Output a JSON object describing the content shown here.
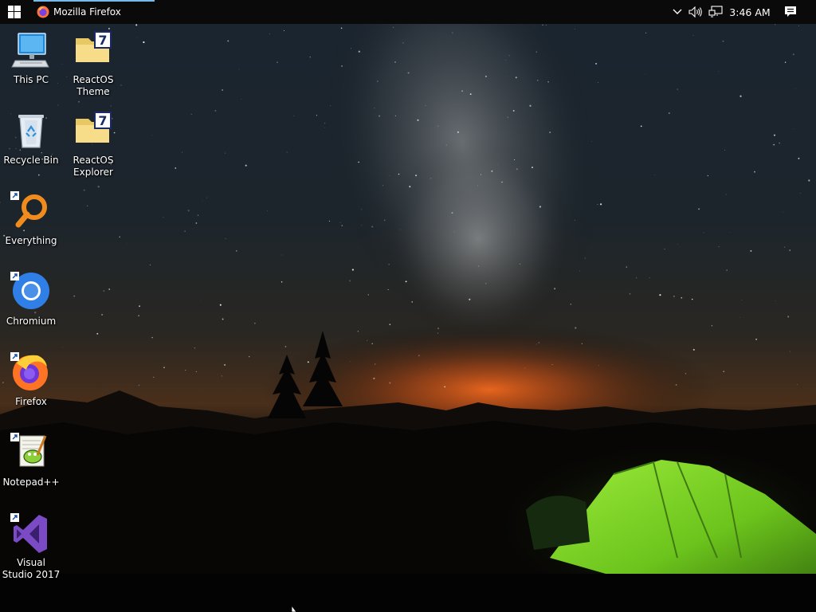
{
  "taskbar": {
    "start_icon": "windows-logo-icon",
    "active_window": {
      "title": "Mozilla Firefox",
      "icon": "firefox-icon"
    },
    "tray": {
      "chevron_icon": "chevron-down-icon",
      "volume_icon": "speaker-icon",
      "network_icon": "network-icon",
      "clock": "3:46 AM",
      "notification_icon": "action-center-icon"
    }
  },
  "desktop": {
    "wallpaper": "night-sky-tent-scene",
    "icons": [
      {
        "label": "This PC",
        "icon": "computer-icon",
        "shortcut": false
      },
      {
        "label": "ReactOS Theme",
        "icon": "folder-icon",
        "shortcut": false
      },
      {
        "label": "Recycle Bin",
        "icon": "recycle-bin-icon",
        "shortcut": false
      },
      {
        "label": "ReactOS Explorer",
        "icon": "folder-icon",
        "shortcut": false
      },
      {
        "label": "Everything",
        "icon": "everything-search-icon",
        "shortcut": true
      },
      {
        "label": "Chromium",
        "icon": "chromium-icon",
        "shortcut": true
      },
      {
        "label": "Firefox",
        "icon": "firefox-icon",
        "shortcut": true
      },
      {
        "label": "Notepad++",
        "icon": "notepadpp-icon",
        "shortcut": true
      },
      {
        "label": "Visual Studio 2017",
        "icon": "visual-studio-icon",
        "shortcut": true
      }
    ]
  },
  "colors": {
    "taskbar_bg": "#0a0a0b",
    "active_task_indicator": "#76b9ed",
    "tent_green": "#7ed321",
    "horizon_glow": "#e0601a"
  }
}
